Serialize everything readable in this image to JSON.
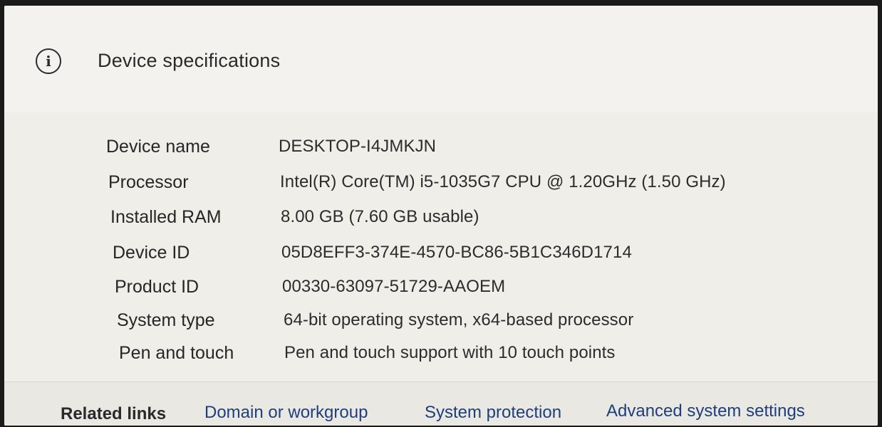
{
  "section": {
    "title": "Device specifications",
    "icon": "info-icon",
    "icon_glyph": "i"
  },
  "specs": [
    {
      "label": "Device name",
      "value": "DESKTOP-I4JMKJN"
    },
    {
      "label": "Processor",
      "value": "Intel(R) Core(TM) i5-1035G7 CPU @ 1.20GHz (1.50 GHz)"
    },
    {
      "label": "Installed RAM",
      "value": "8.00 GB (7.60 GB usable)"
    },
    {
      "label": "Device ID",
      "value": "05D8EFF3-374E-4570-BC86-5B1C346D1714"
    },
    {
      "label": "Product ID",
      "value": "00330-63097-51729-AAOEM"
    },
    {
      "label": "System type",
      "value": "64-bit operating system, x64-based processor"
    },
    {
      "label": "Pen and touch",
      "value": "Pen and touch support with 10 touch points"
    }
  ],
  "related": {
    "label": "Related links",
    "links": [
      "Domain or workgroup",
      "System protection",
      "Advanced system settings"
    ]
  },
  "colors": {
    "link": "#1f3f7a",
    "text": "#2a2a2a",
    "background": "#efeee9"
  }
}
